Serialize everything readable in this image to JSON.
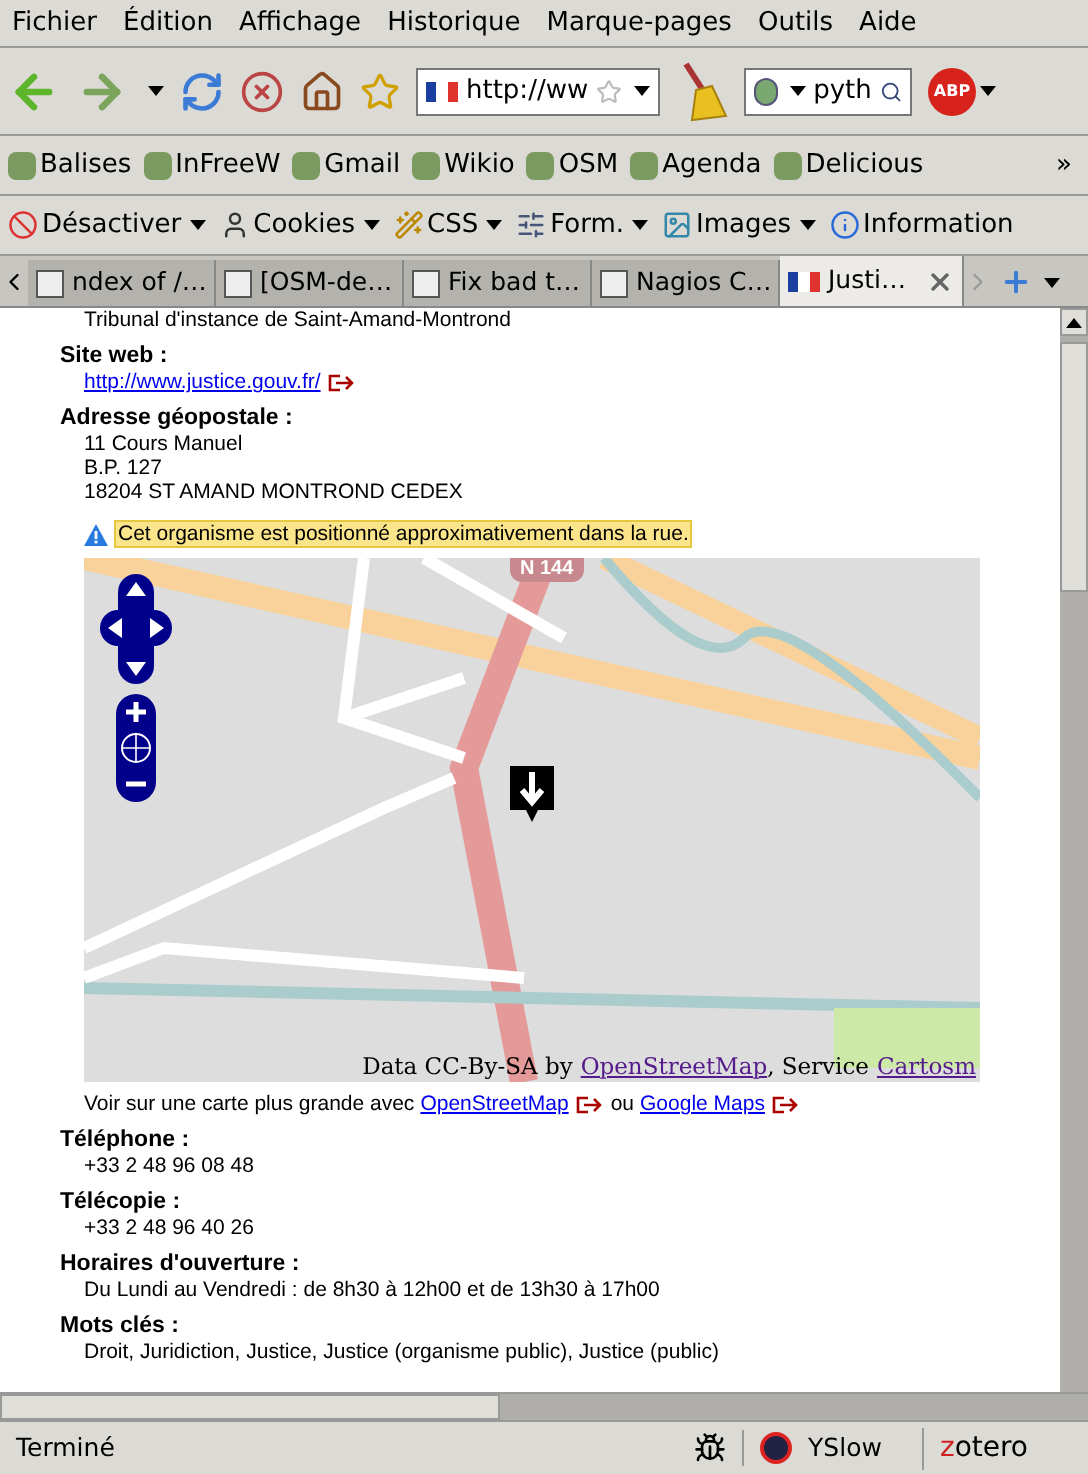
{
  "menu": [
    "Fichier",
    "Édition",
    "Affichage",
    "Historique",
    "Marque-pages",
    "Outils",
    "Aide"
  ],
  "nav": {
    "url": "http://ww",
    "search": "pyth",
    "abp": "ABP"
  },
  "bookmarks": [
    {
      "label": "Balises"
    },
    {
      "label": "InFreeW"
    },
    {
      "label": "Gmail"
    },
    {
      "label": "Wikio"
    },
    {
      "label": "OSM"
    },
    {
      "label": "Agenda"
    },
    {
      "label": "Delicious"
    }
  ],
  "bookmarks_overflow": "»",
  "devtools": [
    {
      "label": "Désactiver",
      "dropdown": true
    },
    {
      "label": "Cookies",
      "dropdown": true
    },
    {
      "label": "CSS",
      "dropdown": true
    },
    {
      "label": "Form.",
      "dropdown": true
    },
    {
      "label": "Images",
      "dropdown": true
    },
    {
      "label": "Information",
      "dropdown": false
    }
  ],
  "tabs": [
    {
      "label": "ndex of /…",
      "selected": false
    },
    {
      "label": "[OSM-de…",
      "selected": false
    },
    {
      "label": "Fix bad t…",
      "selected": false
    },
    {
      "label": "Nagios C…",
      "selected": false
    },
    {
      "label": "Justi…",
      "selected": true
    }
  ],
  "page": {
    "intro": "Tribunal d'instance de Saint-Amand-Montrond",
    "site_label": "Site web :",
    "site_url": "http://www.justice.gouv.fr/",
    "address_label": "Adresse géopostale :",
    "address_lines": [
      "11 Cours Manuel",
      "B.P. 127",
      "18204 ST AMAND MONTROND CEDEX"
    ],
    "notice": "Cet organisme est positionné approximativement dans la rue.",
    "map": {
      "road_label": "N 144",
      "attribution_prefix": "Data CC-By-SA by",
      "attribution_link": "OpenStreetMap",
      "attribution_middle": ", Service",
      "attribution_link2": "Cartosm"
    },
    "larger_map": {
      "prefix": "Voir sur une carte plus grande avec",
      "link": "OpenStreetMap",
      "middle": "ou",
      "link2": "Google Maps"
    },
    "fields": [
      {
        "label": "Téléphone :",
        "value": "+33 2 48 96 08 48"
      },
      {
        "label": "Télécopie :",
        "value": "+33 2 48 96 40 26"
      },
      {
        "label": "Horaires d'ouverture :",
        "value": "Du Lundi au Vendredi : de 8h30 à 12h00 et de 13h30 à 17h00"
      },
      {
        "label": "Mots clés :",
        "value": "Droit, Juridiction, Justice, Justice (organisme public), Justice (public)"
      }
    ]
  },
  "status": {
    "text": "Terminé",
    "yslow": "YSlow",
    "zotero": "zotero"
  }
}
